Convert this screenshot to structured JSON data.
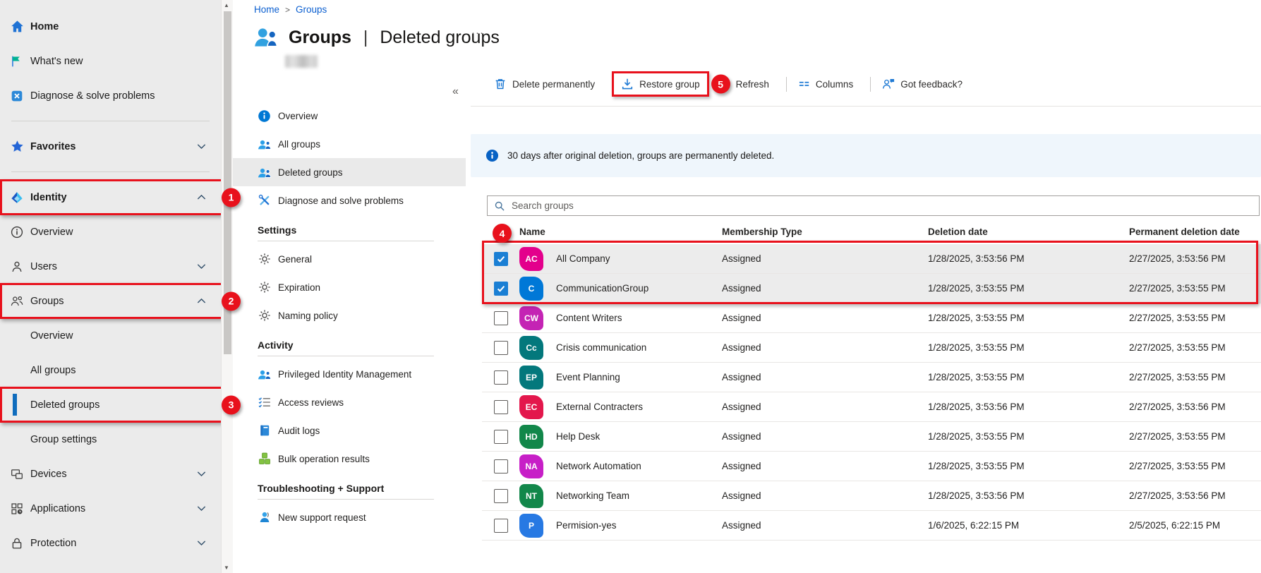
{
  "colors": {
    "annotation": "#e8111c",
    "accent": "#0078d4",
    "selected_row_bg": "#ececec",
    "banner_bg": "#eff6fc",
    "sidebar_bg": "#ebebeb",
    "link": "#0b5fd0"
  },
  "breadcrumb": {
    "items": [
      "Home",
      "Groups"
    ],
    "separator": ">"
  },
  "page": {
    "title_primary": "Groups",
    "title_separator": "|",
    "title_secondary": "Deleted groups",
    "more_label": "···"
  },
  "left_nav": {
    "items": [
      {
        "label": "Home",
        "icon": "home",
        "bold": true
      },
      {
        "label": "What's new",
        "icon": "whats-new"
      },
      {
        "label": "Diagnose & solve problems",
        "icon": "diagnose"
      },
      {
        "divider": true
      },
      {
        "label": "Favorites",
        "icon": "star",
        "bold": true,
        "chevron": "down"
      },
      {
        "divider": true
      },
      {
        "label": "Identity",
        "icon": "identity",
        "bold": true,
        "chevron": "up",
        "annotation": "1"
      },
      {
        "label": "Overview",
        "icon": "info-outline"
      },
      {
        "label": "Users",
        "icon": "user",
        "chevron": "down"
      },
      {
        "label": "Groups",
        "icon": "people-outline",
        "chevron": "up",
        "annotation": "2"
      },
      {
        "label": "Overview",
        "sub": true
      },
      {
        "label": "All groups",
        "sub": true
      },
      {
        "label": "Deleted groups",
        "sub": true,
        "selected": true,
        "annotation": "3"
      },
      {
        "label": "Group settings",
        "sub": true
      },
      {
        "label": "Devices",
        "icon": "devices",
        "chevron": "down"
      },
      {
        "label": "Applications",
        "icon": "applications",
        "chevron": "down"
      },
      {
        "label": "Protection",
        "icon": "protection",
        "chevron": "down"
      }
    ]
  },
  "context_nav": {
    "collapse_glyph": "«",
    "sections": [
      {
        "items": [
          {
            "label": "Overview",
            "icon": "info-filled"
          },
          {
            "label": "All groups",
            "icon": "people-blue"
          },
          {
            "label": "Deleted groups",
            "icon": "people-blue",
            "selected": true
          },
          {
            "label": "Diagnose and solve problems",
            "icon": "tools"
          }
        ]
      },
      {
        "header": "Settings",
        "items": [
          {
            "label": "General",
            "icon": "gear"
          },
          {
            "label": "Expiration",
            "icon": "gear"
          },
          {
            "label": "Naming policy",
            "icon": "gear"
          }
        ]
      },
      {
        "header": "Activity",
        "items": [
          {
            "label": "Privileged Identity Management",
            "icon": "people-blue"
          },
          {
            "label": "Access reviews",
            "icon": "checklist"
          },
          {
            "label": "Audit logs",
            "icon": "book"
          },
          {
            "label": "Bulk operation results",
            "icon": "cubes"
          }
        ]
      },
      {
        "header": "Troubleshooting + Support",
        "items": [
          {
            "label": "New support request",
            "icon": "support"
          }
        ]
      }
    ]
  },
  "toolbar": {
    "items": [
      {
        "label": "Delete permanently",
        "icon": "trash"
      },
      {
        "label": "Restore group",
        "icon": "restore",
        "annotated": true
      },
      {
        "label": "Refresh",
        "annotation": "5"
      },
      {
        "divider": true
      },
      {
        "label": "Columns",
        "icon": "columns"
      },
      {
        "divider": true
      },
      {
        "label": "Got feedback?",
        "icon": "feedback"
      }
    ]
  },
  "banner": {
    "text": "30 days after original deletion, groups are permanently deleted."
  },
  "search": {
    "placeholder": "Search groups"
  },
  "table": {
    "annotation": "4",
    "columns": [
      "Name",
      "Membership Type",
      "Deletion date",
      "Permanent deletion date"
    ],
    "rows": [
      {
        "initials": "AC",
        "color": "#E3008C",
        "name": "All Company",
        "membership": "Assigned",
        "deletion_date": "1/28/2025, 3:53:56 PM",
        "permanent_deletion_date": "2/27/2025, 3:53:56 PM",
        "checked": true,
        "selected": true
      },
      {
        "initials": "C",
        "color": "#0078D7",
        "name": "CommunicationGroup",
        "membership": "Assigned",
        "deletion_date": "1/28/2025, 3:53:55 PM",
        "permanent_deletion_date": "2/27/2025, 3:53:55 PM",
        "checked": true,
        "selected": true
      },
      {
        "initials": "CW",
        "color": "#C424B4",
        "name": "Content Writers",
        "membership": "Assigned",
        "deletion_date": "1/28/2025, 3:53:55 PM",
        "permanent_deletion_date": "2/27/2025, 3:53:55 PM"
      },
      {
        "initials": "Cc",
        "color": "#03787C",
        "name": "Crisis communication",
        "membership": "Assigned",
        "deletion_date": "1/28/2025, 3:53:55 PM",
        "permanent_deletion_date": "2/27/2025, 3:53:55 PM"
      },
      {
        "initials": "EP",
        "color": "#03787C",
        "name": "Event Planning",
        "membership": "Assigned",
        "deletion_date": "1/28/2025, 3:53:55 PM",
        "permanent_deletion_date": "2/27/2025, 3:53:55 PM"
      },
      {
        "initials": "EC",
        "color": "#E3174C",
        "name": "External Contracters",
        "membership": "Assigned",
        "deletion_date": "1/28/2025, 3:53:56 PM",
        "permanent_deletion_date": "2/27/2025, 3:53:56 PM"
      },
      {
        "initials": "HD",
        "color": "#12874A",
        "name": "Help Desk",
        "membership": "Assigned",
        "deletion_date": "1/28/2025, 3:53:55 PM",
        "permanent_deletion_date": "2/27/2025, 3:53:55 PM"
      },
      {
        "initials": "NA",
        "color": "#C71FC7",
        "name": "Network Automation",
        "membership": "Assigned",
        "deletion_date": "1/28/2025, 3:53:55 PM",
        "permanent_deletion_date": "2/27/2025, 3:53:55 PM"
      },
      {
        "initials": "NT",
        "color": "#12874A",
        "name": "Networking Team",
        "membership": "Assigned",
        "deletion_date": "1/28/2025, 3:53:56 PM",
        "permanent_deletion_date": "2/27/2025, 3:53:56 PM"
      },
      {
        "initials": "P",
        "color": "#2779E3",
        "name": "Permision-yes",
        "membership": "Assigned",
        "deletion_date": "1/6/2025, 6:22:15 PM",
        "permanent_deletion_date": "2/5/2025, 6:22:15 PM"
      }
    ]
  },
  "scrollbar": {
    "up_glyph": "▲",
    "down_glyph": "▼"
  }
}
